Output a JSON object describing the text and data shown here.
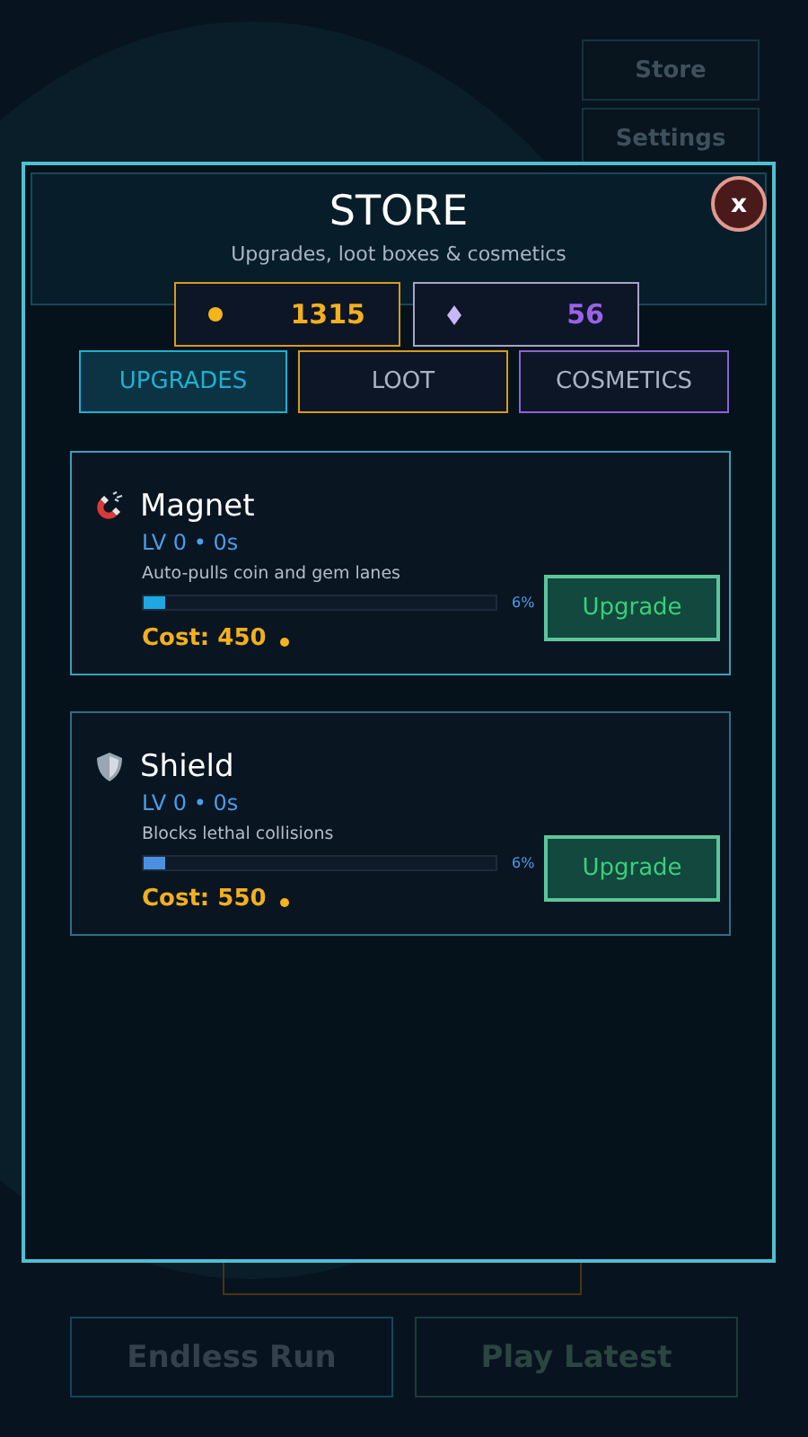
{
  "background": {
    "menu_buttons": [
      "Store",
      "Settings"
    ],
    "play_buttons": [
      {
        "label": "Endless Run",
        "kind": "endless"
      },
      {
        "label": "Play Latest",
        "kind": "latest"
      }
    ]
  },
  "store": {
    "title": "STORE",
    "subtitle": "Upgrades, loot boxes & cosmetics",
    "close": "x",
    "coins": "1315",
    "gems": "56",
    "tabs": [
      {
        "label": "UPGRADES",
        "selected": true,
        "color": "#1fb0d0"
      },
      {
        "label": "LOOT",
        "selected": false,
        "color": "#d99a1c"
      },
      {
        "label": "COSMETICS",
        "selected": false,
        "color": "#8a63d2"
      }
    ],
    "items": [
      {
        "name": "Magnet",
        "kind": "magnet",
        "stats": "LV 0 • 0s",
        "description": "Auto-pulls coin and gem lanes",
        "level": 0.06,
        "color": "#1ea7e0",
        "percent": "6%",
        "cost": "Cost: 450",
        "button": "Upgrade"
      },
      {
        "name": "Shield",
        "kind": "shield",
        "stats": "LV 0 • 0s",
        "description": "Blocks lethal collisions",
        "level": 0.06,
        "color": "#4a90e0",
        "percent": "6%",
        "cost": "Cost: 550",
        "button": "Upgrade"
      }
    ]
  }
}
